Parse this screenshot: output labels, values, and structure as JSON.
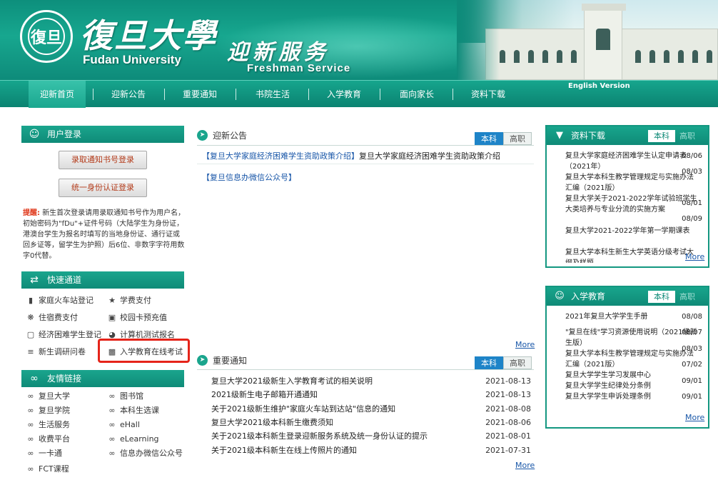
{
  "header": {
    "seal_text": "復旦",
    "logo_cn": "復旦大學",
    "logo_en": "Fudan University",
    "title_cn": "迎新服务",
    "title_en": "Freshman  Service",
    "english_version": "English Version"
  },
  "nav": {
    "items": [
      {
        "label": "迎新首页"
      },
      {
        "label": "迎新公告"
      },
      {
        "label": "重要通知"
      },
      {
        "label": "书院生活"
      },
      {
        "label": "入学教育"
      },
      {
        "label": "面向家长"
      },
      {
        "label": "资料下载"
      }
    ]
  },
  "login": {
    "title": "用户登录",
    "btn_admission": "录取通知书号登录",
    "btn_id": "统一身份认证登录",
    "tip_label": "提醒:",
    "tip_text": "新生首次登录请用录取通知书号作为用户名，初始密码为\"fDu\"+证件号码（大陆学生为身份证，港澳台学生为报名时填写的当地身份证、通行证或回乡证等，留学生为护照）后6位、非数字字符用数字0代替。"
  },
  "quick": {
    "title": "快速通道",
    "links": [
      {
        "label": "家庭火车站登记",
        "icon": "book-icon"
      },
      {
        "label": "学费支付",
        "icon": "star-icon"
      },
      {
        "label": "住宿费支付",
        "icon": "gear-icon"
      },
      {
        "label": "校园卡预充值",
        "icon": "monitor-icon"
      },
      {
        "label": "经济困难学生登记",
        "icon": "window-icon"
      },
      {
        "label": "计算机测试报名",
        "icon": "globe-icon"
      },
      {
        "label": "新生调研问卷",
        "icon": "barbell-icon"
      },
      {
        "label": "入学教育在线考试",
        "icon": "chart-icon"
      }
    ]
  },
  "friends": {
    "title": "友情链接",
    "links": [
      {
        "label": "复旦大学"
      },
      {
        "label": "图书馆"
      },
      {
        "label": "复旦学院"
      },
      {
        "label": "本科生选课"
      },
      {
        "label": "生活服务"
      },
      {
        "label": "eHall"
      },
      {
        "label": "收费平台"
      },
      {
        "label": "eLearning"
      },
      {
        "label": "一卡通"
      },
      {
        "label": "信息办微信公众号"
      },
      {
        "label": "FCT课程"
      }
    ]
  },
  "announce": {
    "title": "迎新公告",
    "tab_on": "本科",
    "tab_off": "高职",
    "item1_link": "【复旦大学家庭经济困难学生资助政策介绍】",
    "item1_text": "复旦大学家庭经济困难学生资助政策介绍",
    "item2_link": "【复旦信息办微信公众号】",
    "more": "More"
  },
  "notices": {
    "title": "重要通知",
    "tab_on": "本科",
    "tab_off": "高职",
    "items": [
      {
        "title": "复旦大学2021级新生入学教育考试的相关说明",
        "date": "2021-08-13"
      },
      {
        "title": "2021级新生电子邮箱开通通知",
        "date": "2021-08-13"
      },
      {
        "title": "关于2021级新生维护\"家庭火车站到达站\"信息的通知",
        "date": "2021-08-08"
      },
      {
        "title": "复旦大学2021级本科新生缴费须知",
        "date": "2021-08-06"
      },
      {
        "title": "关于2021级本科新生登录迎新服务系统及统一身份认证的提示",
        "date": "2021-08-01"
      },
      {
        "title": "关于2021级本科新生在线上传照片的通知",
        "date": "2021-07-31"
      }
    ],
    "more": "More"
  },
  "downloads": {
    "title": "资料下载",
    "tab_on": "本科",
    "tab_off": "高职",
    "items": [
      {
        "title": "复旦大学家庭经济困难学生认定申请表（2021年）",
        "date": "08/06"
      },
      {
        "title": "复旦大学本科生教学管理规定与实施办法汇编（2021版）",
        "date": "08/03"
      },
      {
        "title": "复旦大学关于2021-2022学年试验班学生大类培养与专业分流的实施方案",
        "date": "08/01"
      },
      {
        "title": "复旦大学2021-2022学年第一学期课表",
        "date": "08/09"
      },
      {
        "title": "复旦大学本科生新生大学英语分级考试大纲及样题",
        "date": ""
      }
    ],
    "more": "More"
  },
  "education": {
    "title": "入学教育",
    "tab_on": "本科",
    "tab_off": "高职",
    "items": [
      {
        "title": "2021年复旦大学学生手册",
        "date": "08/08"
      },
      {
        "title": "\"复旦在线\"学习资源使用说明（2021级新生版）",
        "date": "08/07"
      },
      {
        "title": "复旦大学本科生教学管理规定与实施办法汇编（2021版）",
        "date": "08/03"
      },
      {
        "title": "复旦大学学生学习发展中心",
        "date": "07/02"
      },
      {
        "title": "复旦大学学生纪律处分条例",
        "date": "09/01"
      },
      {
        "title": "复旦大学学生申诉处理条例",
        "date": "09/01"
      }
    ],
    "more": "More"
  },
  "colors": {
    "brand_teal": "#0f8b78",
    "tab_blue": "#1e84c8",
    "highlight_red": "#e5241a",
    "button_text": "#b33b1a"
  }
}
